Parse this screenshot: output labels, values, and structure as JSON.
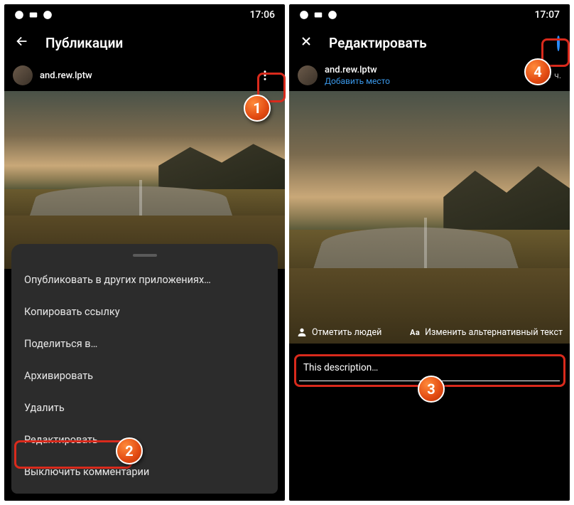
{
  "left": {
    "status": {
      "time": "17:06"
    },
    "header": {
      "title": "Публикации"
    },
    "post": {
      "username": "and.rew.lptw"
    },
    "sheet": {
      "items": [
        "Опубликовать в других приложениях…",
        "Копировать ссылку",
        "Поделиться в…",
        "Архивировать",
        "Удалить",
        "Редактировать",
        "Выключить комментарии"
      ]
    }
  },
  "right": {
    "status": {
      "time": "17:07"
    },
    "header": {
      "title": "Редактировать"
    },
    "post": {
      "username": "and.rew.lptw",
      "add_place": "Добавить место",
      "timeago": "1 ч."
    },
    "overlay": {
      "tag_people": "Отметить людей",
      "alt_text": "Изменить альтернативный текст"
    },
    "caption": "This description…"
  },
  "callouts": {
    "c1": "1",
    "c2": "2",
    "c3": "3",
    "c4": "4"
  }
}
